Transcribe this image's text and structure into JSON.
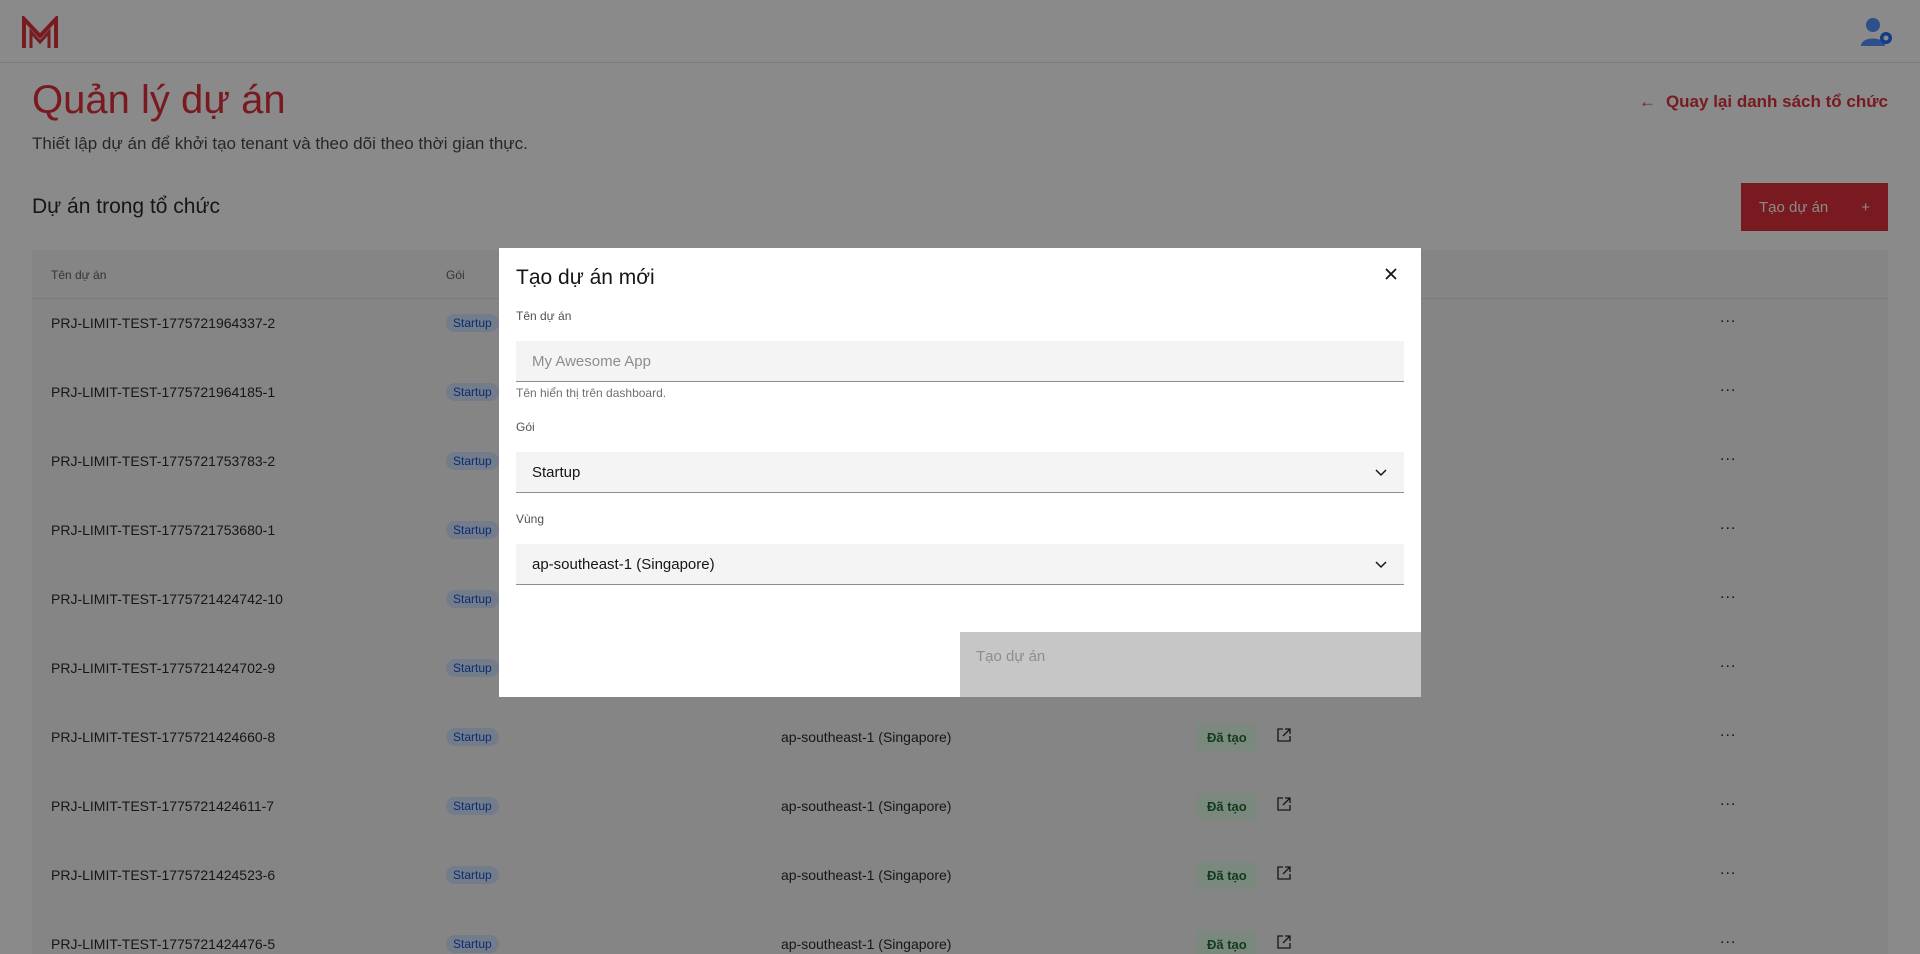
{
  "header": {
    "logo": "brand-m-logo",
    "user_icon": "user-gear-icon"
  },
  "page": {
    "title": "Quản lý dự án",
    "subtitle": "Thiết lập dự án để khởi tạo tenant và theo dõi theo thời gian thực.",
    "back_label": "Quay lại danh sách tổ chức",
    "section_title": "Dự án trong tổ chức",
    "create_button": "Tạo dự án",
    "create_button_icon": "+"
  },
  "table": {
    "headers": [
      "Tên dự án",
      "Gói"
    ],
    "rows": [
      {
        "name": "PRJ-LIMIT-TEST-1775721964337-2",
        "plan": "Startup",
        "region": "",
        "status": ""
      },
      {
        "name": "PRJ-LIMIT-TEST-1775721964185-1",
        "plan": "Startup",
        "region": "",
        "status": ""
      },
      {
        "name": "PRJ-LIMIT-TEST-1775721753783-2",
        "plan": "Startup",
        "region": "",
        "status": ""
      },
      {
        "name": "PRJ-LIMIT-TEST-1775721753680-1",
        "plan": "Startup",
        "region": "",
        "status": ""
      },
      {
        "name": "PRJ-LIMIT-TEST-1775721424742-10",
        "plan": "Startup",
        "region": "",
        "status": ""
      },
      {
        "name": "PRJ-LIMIT-TEST-1775721424702-9",
        "plan": "Startup",
        "region": "",
        "status": ""
      },
      {
        "name": "PRJ-LIMIT-TEST-1775721424660-8",
        "plan": "Startup",
        "region": "ap-southeast-1 (Singapore)",
        "status": "Đã tạo"
      },
      {
        "name": "PRJ-LIMIT-TEST-1775721424611-7",
        "plan": "Startup",
        "region": "ap-southeast-1 (Singapore)",
        "status": "Đã tạo"
      },
      {
        "name": "PRJ-LIMIT-TEST-1775721424523-6",
        "plan": "Startup",
        "region": "ap-southeast-1 (Singapore)",
        "status": "Đã tạo"
      },
      {
        "name": "PRJ-LIMIT-TEST-1775721424476-5",
        "plan": "Startup",
        "region": "ap-southeast-1 (Singapore)",
        "status": "Đã tạo"
      }
    ],
    "more_label": "..."
  },
  "modal": {
    "title": "Tạo dự án mới",
    "name_label": "Tên dự án",
    "name_placeholder": "My Awesome App",
    "name_helper": "Tên hiển thị trên dashboard.",
    "plan_label": "Gói",
    "plan_value": "Startup",
    "region_label": "Vùng",
    "region_value": "ap-southeast-1 (Singapore)",
    "submit_label": "Tạo dự án"
  },
  "colors": {
    "accent": "#da1e28",
    "overlay": "rgba(22,22,22,0.5)"
  }
}
